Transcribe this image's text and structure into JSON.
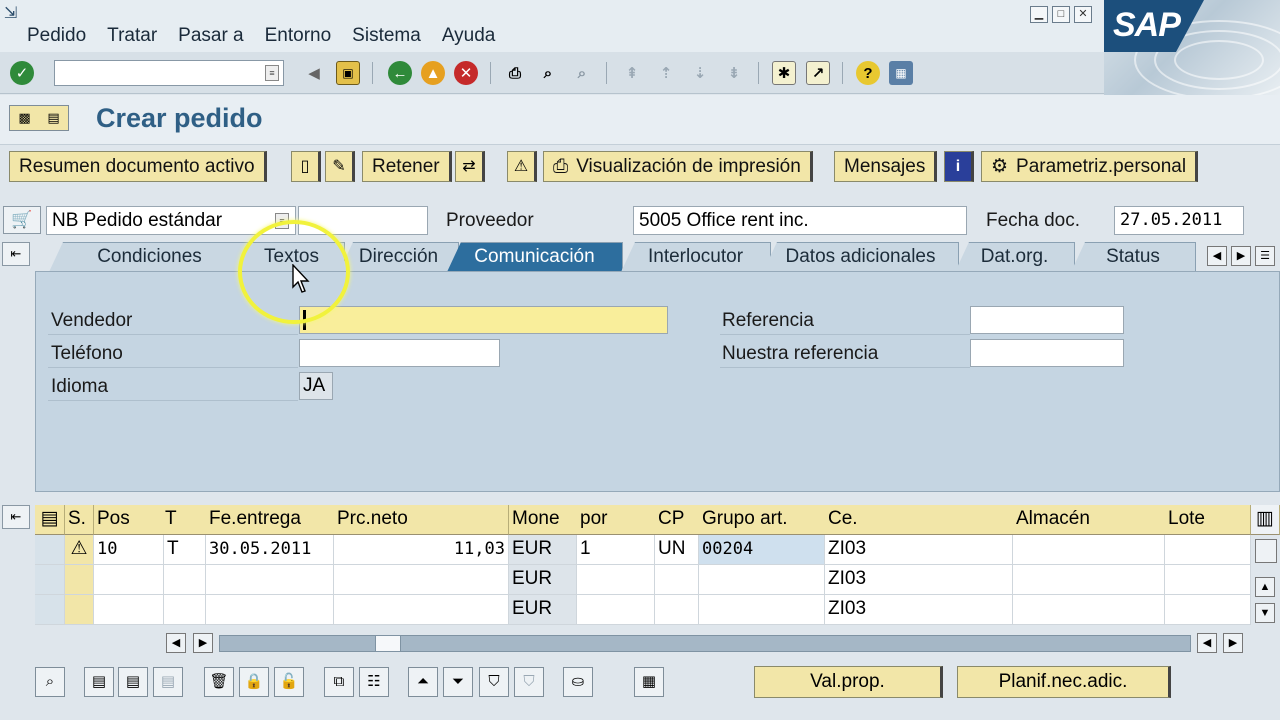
{
  "menu": {
    "items": [
      "Pedido",
      "Tratar",
      "Pasar a",
      "Entorno",
      "Sistema",
      "Ayuda"
    ]
  },
  "toolbar": {
    "command_value": ""
  },
  "title": "Crear pedido",
  "app_toolbar": {
    "resumen": "Resumen documento activo",
    "retener": "Retener",
    "visualizacion": "Visualización de impresión",
    "mensajes": "Mensajes",
    "parametriz": "Parametriz.personal"
  },
  "header": {
    "doc_type": "NB Pedido estándar",
    "doc_number": "",
    "proveedor_label": "Proveedor",
    "proveedor_value": "5005 Office rent inc.",
    "fecha_label": "Fecha doc.",
    "fecha_value": "27.05.2011"
  },
  "tabs": [
    {
      "label": "Condiciones"
    },
    {
      "label": "Textos"
    },
    {
      "label": "Dirección"
    },
    {
      "label": "Comunicación",
      "active": true
    },
    {
      "label": "Interlocutor"
    },
    {
      "label": "Datos adicionales"
    },
    {
      "label": "Dat.org."
    },
    {
      "label": "Status"
    }
  ],
  "comunicacion": {
    "vendedor_label": "Vendedor",
    "vendedor_value": "",
    "telefono_label": "Teléfono",
    "telefono_value": "",
    "idioma_label": "Idioma",
    "idioma_value": "JA",
    "referencia_label": "Referencia",
    "referencia_value": "",
    "nuestra_label": "Nuestra referencia",
    "nuestra_value": ""
  },
  "table": {
    "headers": [
      "S.",
      "Pos",
      "T",
      "Fe.entrega",
      "Prc.neto",
      "Mone",
      "por",
      "CP",
      "Grupo art.",
      "Ce.",
      "Almacén",
      "Lote"
    ],
    "rows": [
      {
        "status": "warning",
        "pos": "10",
        "t": "T",
        "fecha": "30.05.2011",
        "precio": "11,03",
        "mone": "EUR",
        "por": "1",
        "cp": "UN",
        "grupo": "00204",
        "ce": "ZI03",
        "almacen": "",
        "lote": ""
      },
      {
        "status": "",
        "pos": "",
        "t": "",
        "fecha": "",
        "precio": "",
        "mone": "EUR",
        "por": "",
        "cp": "",
        "grupo": "",
        "ce": "ZI03",
        "almacen": "",
        "lote": ""
      },
      {
        "status": "",
        "pos": "",
        "t": "",
        "fecha": "",
        "precio": "",
        "mone": "EUR",
        "por": "",
        "cp": "",
        "grupo": "",
        "ce": "ZI03",
        "almacen": "",
        "lote": ""
      }
    ]
  },
  "bottom": {
    "valprop": "Val.prop.",
    "planif": "Planif.nec.adic."
  },
  "colors": {
    "title": "#2f5f85",
    "active_tab": "#2d6e9e",
    "button_face": "#f2e6a8",
    "highlight_ring": "#f1f23c",
    "panel": "#c5d5e2"
  },
  "logo": {
    "text": "SAP"
  }
}
